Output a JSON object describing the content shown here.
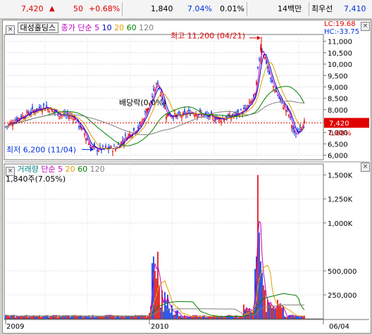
{
  "quote_bar": {
    "price": "7,420",
    "change_arrow": "▲",
    "change": "50",
    "change_rate": "+0.68%",
    "volume": "1,840",
    "volume_ratio": "7.04%",
    "turnover": "0.01%",
    "amount": "14백만",
    "preferred_label": "최우선",
    "preferred_price": "7,410"
  },
  "price_panel": {
    "stock_name": "대성홀딩스",
    "legend_prefix": "종가 단순",
    "ma_periods": [
      "5",
      "10",
      "20",
      "60",
      "120"
    ],
    "lc": "LC:19.68",
    "hc": "HC:-33.75",
    "high_annotation": "최고 11,200 (04/21)",
    "low_annotation": "최저 6,200 (11/04)",
    "dividend_annotation": "배당락(0.0%)",
    "current_price_tag": "7,420",
    "current_change_tag": "0.68%",
    "y_ticks": [
      "11,000",
      "10,500",
      "10,000",
      "9,500",
      "9,000",
      "8,500",
      "8,000",
      "7,500",
      "7,000",
      "6,500",
      "6,000"
    ]
  },
  "volume_panel": {
    "legend_prefix": "거래량",
    "legend_ma_label": "단순",
    "ma_periods": [
      "5",
      "20",
      "60",
      "120"
    ],
    "current_volume": "1,840주(7.05%)",
    "y_ticks": [
      "1,500K",
      "1,250K",
      "1,000K",
      "500,000",
      "250,000"
    ]
  },
  "x_axis": {
    "labels": [
      "2009",
      "2010",
      "06/04"
    ]
  },
  "colors": {
    "up": "#e00000",
    "down": "#0030e0",
    "ma5": "#c000c0",
    "ma10": "#0000c0",
    "ma20": "#e0a000",
    "ma60": "#008000",
    "ma120": "#808080"
  },
  "close_icon": "close-icon"
}
